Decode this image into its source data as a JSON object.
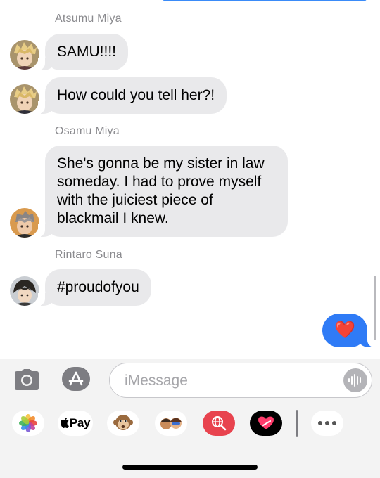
{
  "conversation": {
    "groups": [
      {
        "sender": "Atsumu Miya",
        "messages": [
          "SAMU!!!!",
          "How could you tell her?!"
        ]
      },
      {
        "sender": "Osamu Miya",
        "messages": [
          "She's gonna be my sister in law someday. I had to prove myself with the juiciest piece of blackmail I knew."
        ]
      },
      {
        "sender": "Rintaro Suna",
        "messages": [
          "#proudofyou"
        ]
      }
    ],
    "outgoing": {
      "content": "❤️",
      "bubble_color": "#2f7bf6"
    },
    "incoming_bubble_color": "#e9e9eb"
  },
  "compose": {
    "placeholder": "iMessage",
    "camera_icon": "camera-icon",
    "appstore_icon": "app-store-icon",
    "audio_icon": "audio-waveform-icon"
  },
  "app_drawer": {
    "items": [
      {
        "name": "photos",
        "icon": "photos-icon"
      },
      {
        "name": "apple-pay",
        "label": "Pay",
        "icon": "apple-logo-icon"
      },
      {
        "name": "animoji",
        "icon": "monkey-icon"
      },
      {
        "name": "memoji",
        "icon": "memoji-icon"
      },
      {
        "name": "image-search",
        "icon": "globe-search-icon"
      },
      {
        "name": "digital-touch",
        "icon": "heart-touch-icon"
      },
      {
        "name": "more",
        "icon": "more-icon"
      }
    ]
  }
}
